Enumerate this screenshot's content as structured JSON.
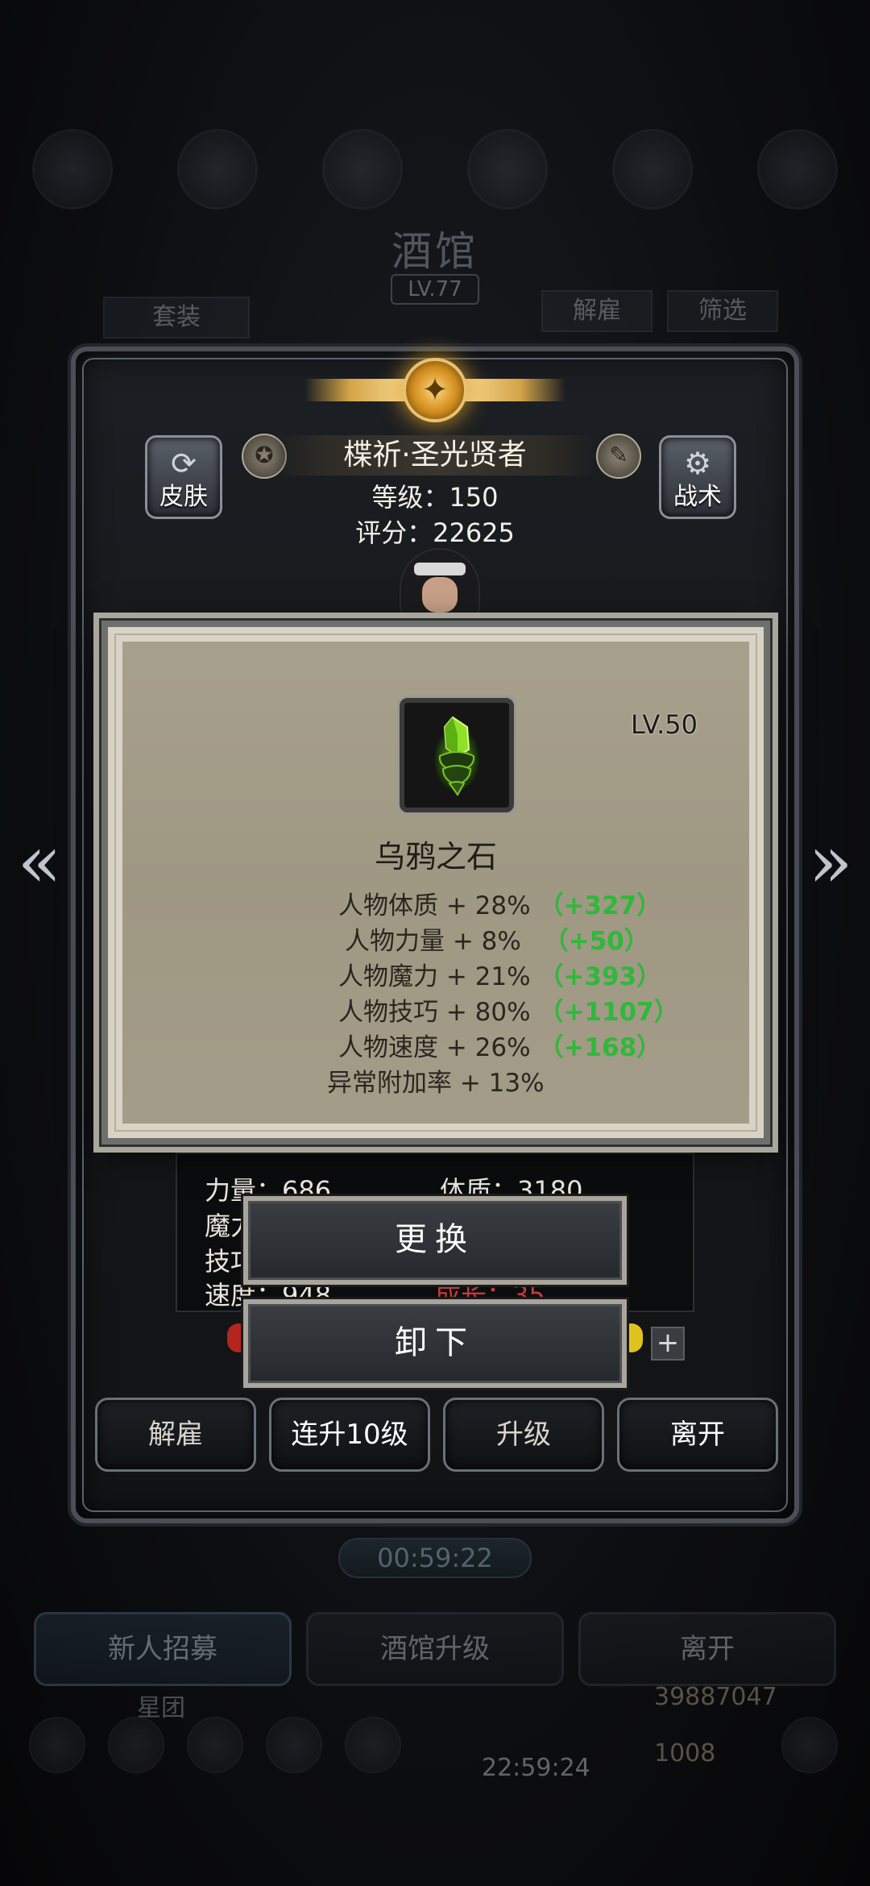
{
  "background": {
    "title": "酒馆",
    "level": "LV.77",
    "left_tab": "套装",
    "dismiss_top": "解雇",
    "filter": "筛选",
    "timer": "00:59:22",
    "bottom_buttons": [
      "新人招募",
      "酒馆升级",
      "离开"
    ],
    "faded_label": "星团",
    "gold": "39887047",
    "gems": "1008",
    "footer_timer": "22:59:24"
  },
  "hero": {
    "name": "楪祈·圣光贤者",
    "level_text": "等级：150",
    "score_text": "评分：22625",
    "skin_label": "皮肤",
    "tactics_label": "战术",
    "stats": {
      "strength": "力量：686",
      "constitution": "体质：3180",
      "magic_fragment": "魔力",
      "skill_fragment": "技巧",
      "speed_fragment": "速度：948",
      "growth": "成长：35"
    },
    "actions": [
      "解雇",
      "连升10级",
      "升级",
      "离开"
    ]
  },
  "item": {
    "level": "LV.50",
    "name": "乌鸦之石",
    "stats": [
      {
        "text": "人物体质 + 28%",
        "bonus": "（+327）"
      },
      {
        "text": "人物力量 + 8%",
        "bonus": "（+50）"
      },
      {
        "text": "人物魔力 + 21%",
        "bonus": "（+393）"
      },
      {
        "text": "人物技巧 + 80%",
        "bonus": "（+1107）"
      },
      {
        "text": "人物速度 + 26%",
        "bonus": "（+168）"
      },
      {
        "text": "异常附加率 + 13%",
        "bonus": ""
      }
    ]
  },
  "menu": {
    "replace": "更换",
    "unequip": "卸下"
  },
  "colors": {
    "bonus_green": "#2fb83a",
    "growth_red": "#c43a3a",
    "gold_accent": "#d4a448"
  }
}
